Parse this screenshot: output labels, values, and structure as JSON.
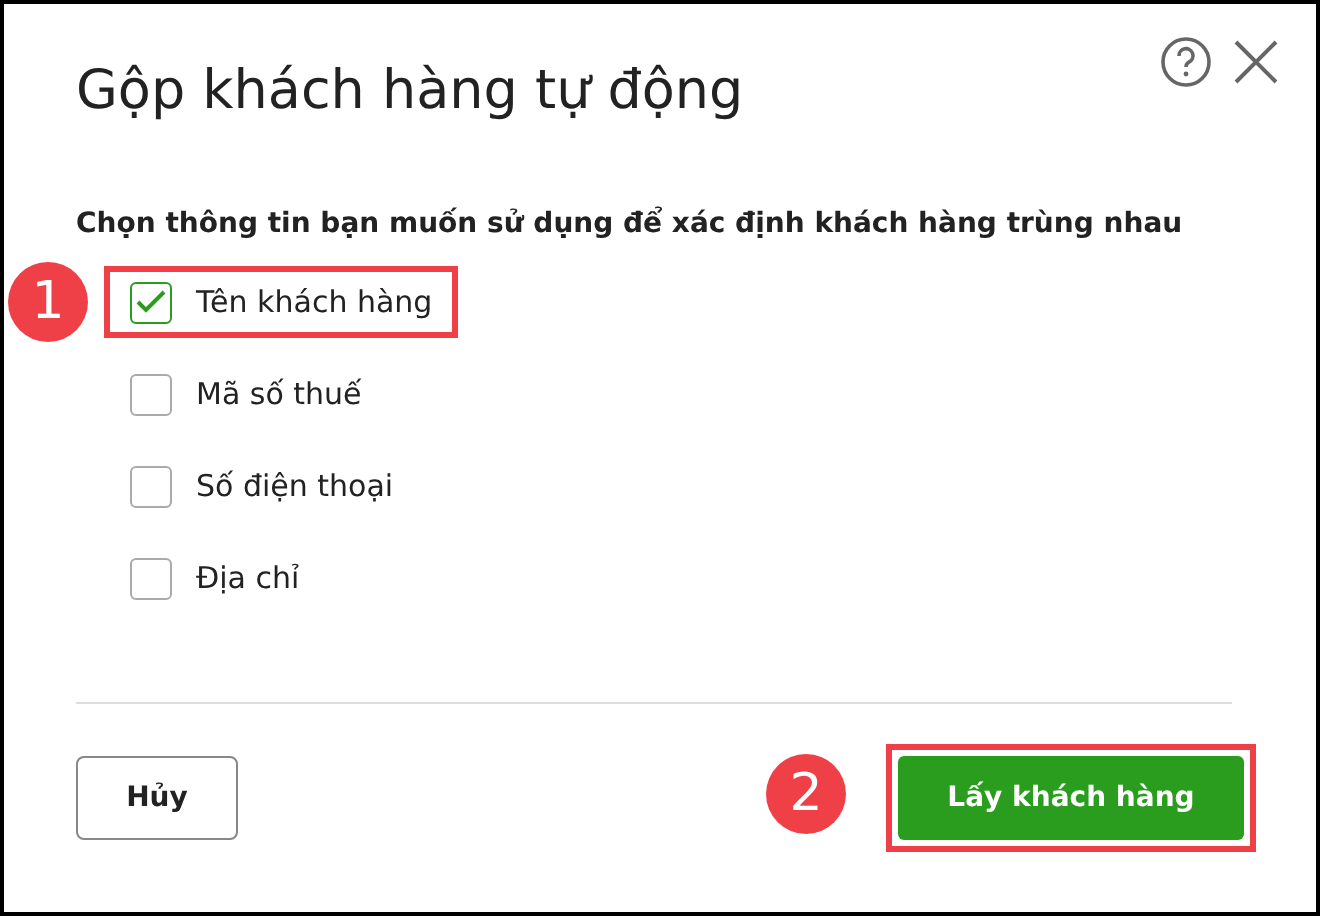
{
  "dialog": {
    "title": "Gộp khách hàng tự động",
    "instruction": "Chọn thông tin bạn muốn sử dụng để xác định khách hàng trùng nhau"
  },
  "options": [
    {
      "label": "Tên khách hàng",
      "checked": true,
      "highlighted": true,
      "step": "1"
    },
    {
      "label": "Mã số thuế",
      "checked": false,
      "highlighted": false
    },
    {
      "label": "Số điện thoại",
      "checked": false,
      "highlighted": false
    },
    {
      "label": "Địa chỉ",
      "checked": false,
      "highlighted": false
    }
  ],
  "buttons": [
    {
      "kind": "secondary",
      "label": "Hủy",
      "highlighted": false
    },
    {
      "kind": "primary",
      "label": "Lấy khách hàng",
      "highlighted": true,
      "step": "2"
    }
  ]
}
